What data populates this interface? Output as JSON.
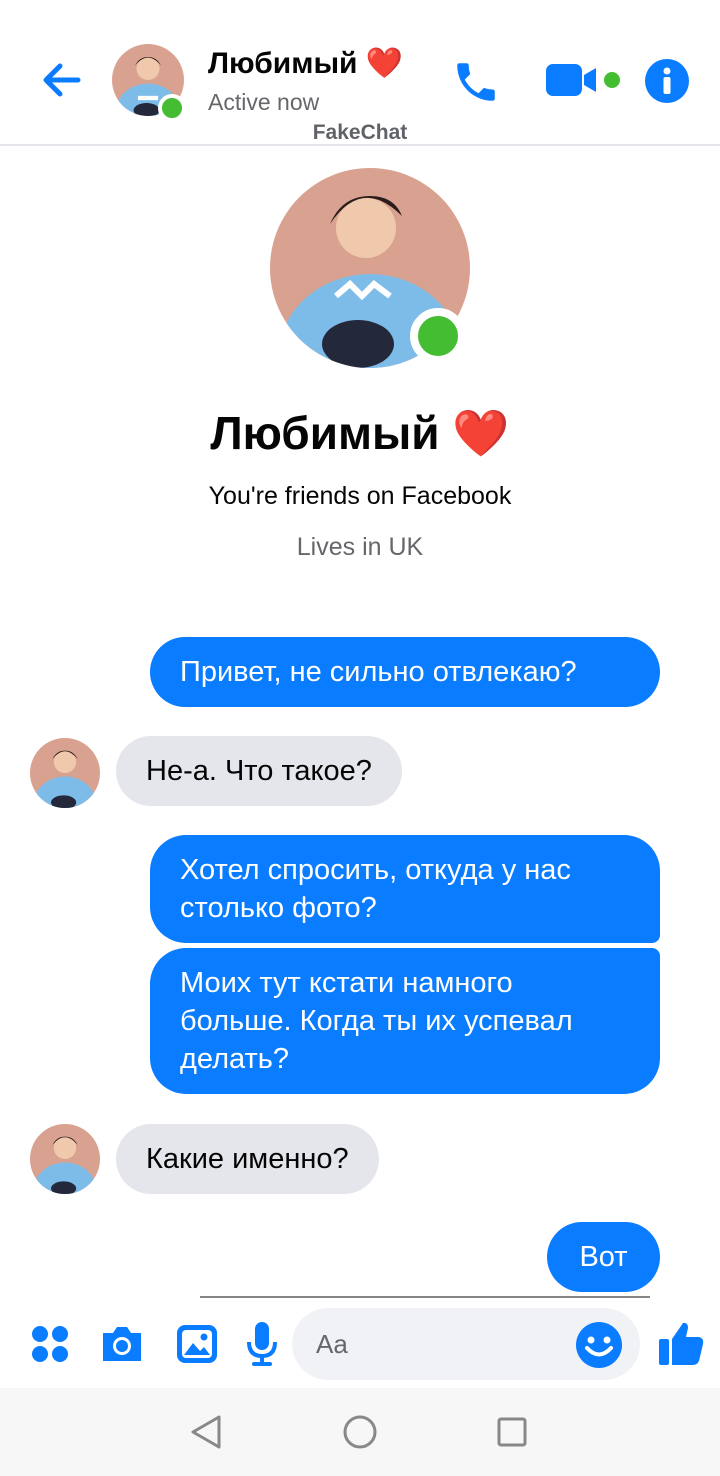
{
  "header": {
    "name": "Любимый ❤️",
    "status": "Active now",
    "watermark": "FakeChat"
  },
  "profile": {
    "name": "Любимый ❤️",
    "friends_text": "You're friends on Facebook",
    "lives_text": "Lives in UK"
  },
  "messages": [
    {
      "side": "out",
      "text": "Привет, не сильно отвлекаю?"
    },
    {
      "side": "in",
      "text": "Не-а. Что такое?"
    },
    {
      "side": "out",
      "text": "Хотел спросить, откуда у нас столько фото?"
    },
    {
      "side": "out",
      "text": "Моих тут кстати намного больше. Когда ты их успевал делать?"
    },
    {
      "side": "in",
      "text": "Какие именно?"
    },
    {
      "side": "out",
      "text": "Вот"
    }
  ],
  "composer": {
    "placeholder": "Aa"
  },
  "icons": {
    "back": "arrow-left-icon",
    "call": "phone-icon",
    "video": "video-camera-icon",
    "info": "info-icon",
    "apps": "grid-icon",
    "camera": "camera-icon",
    "gallery": "image-icon",
    "mic": "microphone-icon",
    "emoji": "smiley-icon",
    "like": "thumbs-up-icon"
  },
  "colors": {
    "accent": "#0a7cff",
    "online": "#44bd32",
    "incoming_bubble": "#e4e6eb"
  }
}
